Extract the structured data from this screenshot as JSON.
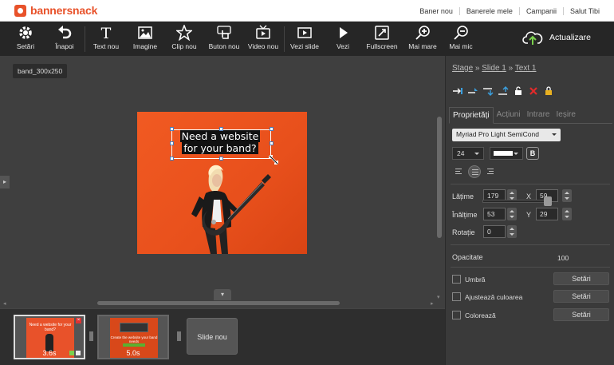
{
  "brand": {
    "name": "bannersnack",
    "color": "#e8522a"
  },
  "topnav": {
    "items": [
      "Baner nou",
      "Banerele mele",
      "Campanii"
    ],
    "greeting": "Salut Tibi"
  },
  "toolbar": {
    "items": [
      {
        "label": "Setări",
        "icon": "gear-icon"
      },
      {
        "label": "Înapoi",
        "icon": "undo-icon"
      },
      {
        "label": "Text nou",
        "icon": "text-icon"
      },
      {
        "label": "Imagine",
        "icon": "image-icon"
      },
      {
        "label": "Clip nou",
        "icon": "star-icon"
      },
      {
        "label": "Buton nou",
        "icon": "hand-pointer-icon"
      },
      {
        "label": "Video nou",
        "icon": "tv-icon"
      },
      {
        "label": "Vezi slide",
        "icon": "slide-play-icon"
      },
      {
        "label": "Vezi",
        "icon": "play-icon"
      },
      {
        "label": "Fullscreen",
        "icon": "fullscreen-icon"
      },
      {
        "label": "Mai mare",
        "icon": "zoom-in-icon"
      },
      {
        "label": "Mai mic",
        "icon": "zoom-out-icon"
      }
    ],
    "upload_label": "Actualizare"
  },
  "workspace": {
    "size_label": "band_300x250",
    "headline_line1": "Need a website",
    "headline_line2": "for your band?"
  },
  "filmstrip": {
    "slides": [
      {
        "duration": "3.6s",
        "thumb_text": "Need a website for your band?"
      },
      {
        "duration": "5.0s",
        "thumb_text": "Create the website your band needs"
      }
    ],
    "new_slide_label": "Slide nou"
  },
  "panel": {
    "breadcrumb": [
      "Stage",
      "Slide 1",
      "Text 1"
    ],
    "tabs": [
      "Proprietăți",
      "Acțiuni",
      "Intrare",
      "Ieșire"
    ],
    "font_family": "Myriad Pro Light SemiCond",
    "font_size": "24",
    "bold_label": "B",
    "text_color": "#ffffff",
    "fields": {
      "width_label": "Lățime",
      "width": "179",
      "x_label": "X",
      "x": "59",
      "height_label": "Înălțime",
      "height": "53",
      "y_label": "Y",
      "y": "29",
      "rotation_label": "Rotație",
      "rotation": "0"
    },
    "opacity_label": "Opacitate",
    "opacity_value": "100",
    "effects": [
      {
        "label": "Umbră",
        "button": "Setări"
      },
      {
        "label": "Ajustează culoarea",
        "button": "Setări"
      },
      {
        "label": "Colorează",
        "button": "Setări"
      }
    ]
  }
}
